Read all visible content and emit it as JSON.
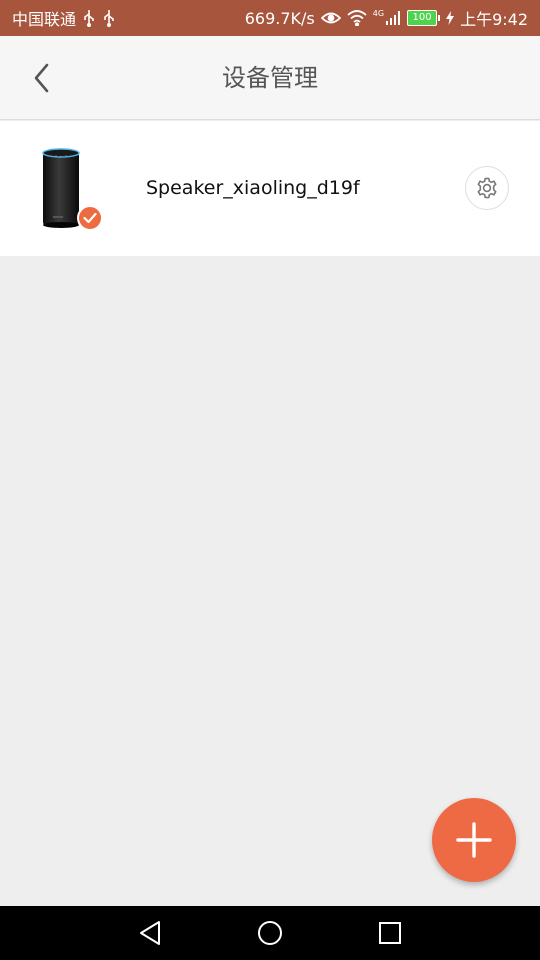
{
  "status_bar": {
    "carrier": "中国联通",
    "net_speed": "669.7K/s",
    "network_type": "4G",
    "battery_level": "100",
    "time": "上午9:42",
    "icons": [
      "usb-icon",
      "usb-icon",
      "eye-icon",
      "wifi-icon",
      "signal-icon",
      "battery-icon",
      "charging-icon"
    ],
    "background_color": "#a8553d"
  },
  "header": {
    "title": "设备管理",
    "back_icon": "chevron-left-icon"
  },
  "devices": [
    {
      "name": "Speaker_xiaoling_d19f",
      "image_icon": "smart-speaker-icon",
      "selected": true,
      "settings_icon": "gear-icon"
    }
  ],
  "fab": {
    "icon": "plus-icon",
    "color": "#ee6a45"
  },
  "nav_bar": {
    "buttons": [
      "back-triangle-icon",
      "home-circle-icon",
      "recents-square-icon"
    ]
  },
  "accent_color": "#ee6a3f"
}
